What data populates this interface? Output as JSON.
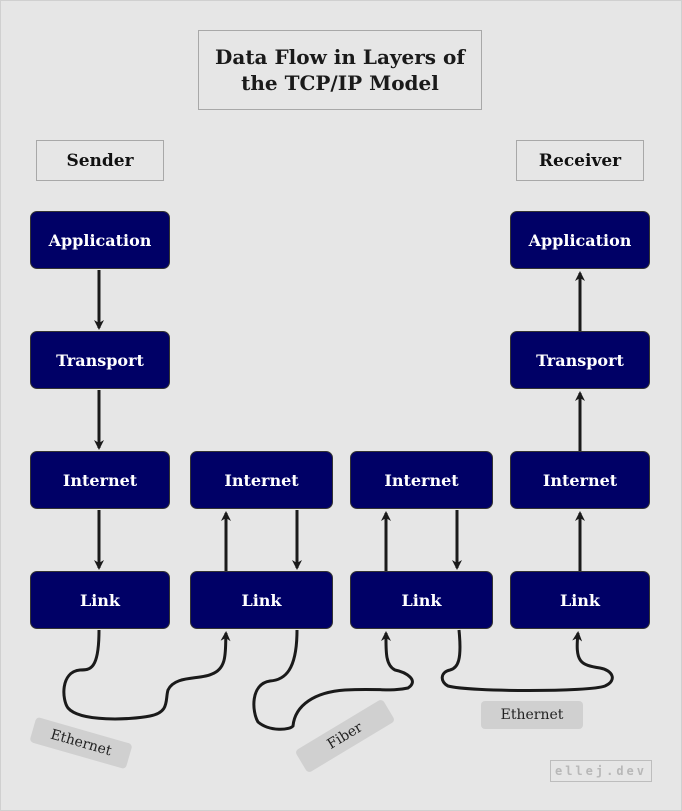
{
  "title": "Data Flow in Layers of the TCP/IP Model",
  "headers": {
    "sender": "Sender",
    "receiver": "Receiver"
  },
  "columns": [
    {
      "name": "sender",
      "layers": [
        "Application",
        "Transport",
        "Internet",
        "Link"
      ],
      "direction": "down"
    },
    {
      "name": "router-1",
      "layers": [
        "Internet",
        "Link"
      ],
      "direction": "up-down"
    },
    {
      "name": "router-2",
      "layers": [
        "Internet",
        "Link"
      ],
      "direction": "up-down"
    },
    {
      "name": "receiver",
      "layers": [
        "Application",
        "Transport",
        "Internet",
        "Link"
      ],
      "direction": "up"
    }
  ],
  "media": [
    "Ethernet",
    "Fiber",
    "Ethernet"
  ],
  "brand": "ellej.dev",
  "colors": {
    "box": "#000066",
    "background": "#e6e6e6",
    "tag": "#d0d0d0",
    "arrow": "#1a1a1a"
  }
}
